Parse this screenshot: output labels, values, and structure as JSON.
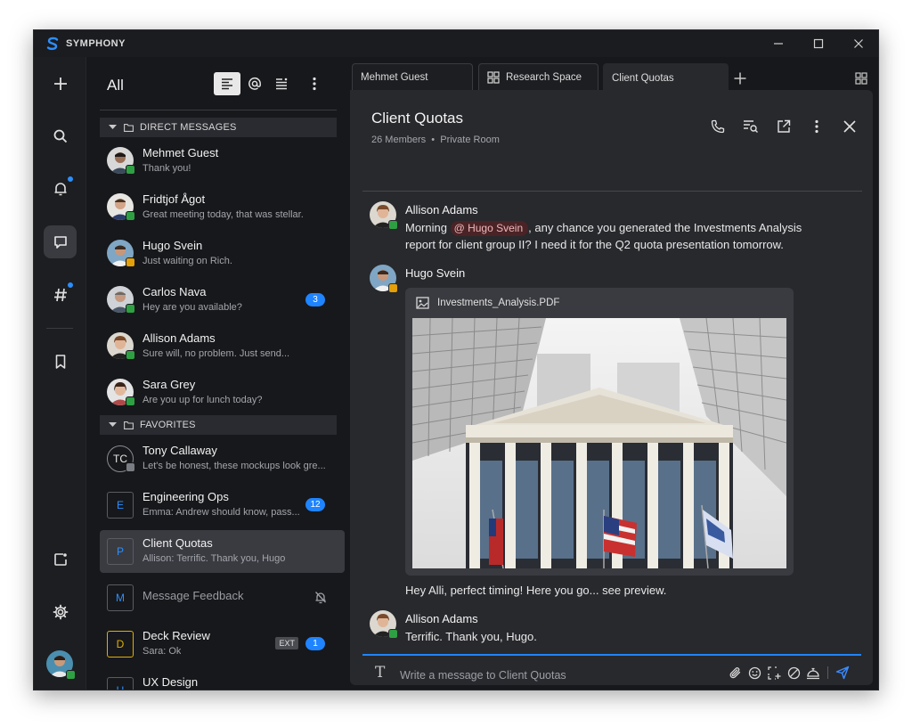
{
  "app": {
    "name": "SYMPHONY"
  },
  "colors": {
    "accent": "#1f84ff",
    "online": "#2ea043",
    "away": "#e3a008",
    "background": "#17181b"
  },
  "left_nav": {
    "items": [
      "plus-icon",
      "search-icon",
      "bell-icon",
      "chat-icon",
      "hashtag-icon",
      "bookmark-icon",
      "share-icon",
      "gear-icon"
    ],
    "active": "chat-icon",
    "unread_dots": [
      "bell-icon",
      "hashtag-icon"
    ]
  },
  "conv_list": {
    "title": "All",
    "sections": {
      "direct": "DIRECT MESSAGES",
      "favorites": "FAVORITES"
    },
    "direct_messages": [
      {
        "name": "Mehmet Guest",
        "preview": "Thank you!",
        "status": "online"
      },
      {
        "name": "Fridtjof Ågot",
        "preview": "Great meeting today, that was stellar.",
        "status": "online"
      },
      {
        "name": "Hugo Svein",
        "preview": "Just waiting on Rich.",
        "status": "away"
      },
      {
        "name": "Carlos Nava",
        "preview": "Hey are you available?",
        "status": "online",
        "badge": "3"
      },
      {
        "name": "Allison Adams",
        "preview": "Sure will, no problem. Just send...",
        "status": "online"
      },
      {
        "name": "Sara Grey",
        "preview": "Are you up for lunch today?",
        "status": "online"
      }
    ],
    "favorites": [
      {
        "name": "Tony Callaway",
        "initials": "TC",
        "preview": "Let's be honest, these mockups look gre...",
        "status": "offline"
      },
      {
        "name": "Engineering Ops",
        "initial": "E",
        "preview": "Emma: Andrew should know, pass...",
        "badge": "12"
      },
      {
        "name": "Client Quotas",
        "initial": "P",
        "preview": "Allison: Terrific. Thank you, Hugo",
        "selected": true
      },
      {
        "name": "Message Feedback",
        "initial": "M",
        "muted": true
      },
      {
        "name": "Deck Review",
        "initial": "D",
        "preview": "Sara: Ok",
        "tag": "EXT",
        "badge": "1"
      },
      {
        "name": "UX Design",
        "initial": "U"
      }
    ]
  },
  "tabs": [
    {
      "label": "Mehmet Guest"
    },
    {
      "label": "Research Space"
    },
    {
      "label": "Client Quotas",
      "active": true
    }
  ],
  "room": {
    "title": "Client Quotas",
    "members": "26 Members",
    "privacy": "Private Room"
  },
  "messages": [
    {
      "author": "Allison Adams",
      "text_before": "Morning ",
      "mention": "Hugo Svein",
      "text_after": ", any chance you generated the Investments Analysis report for client group II? I need it for the Q2 quota presentation tomorrow."
    },
    {
      "author": "Hugo Svein",
      "attachment": "Investments_Analysis.PDF",
      "text": "Hey Alli, perfect timing! Here you go... see preview."
    },
    {
      "author": "Allison Adams",
      "text": "Terrific. Thank you, Hugo."
    }
  ],
  "composer": {
    "placeholder": "Write a message to Client Quotas"
  }
}
